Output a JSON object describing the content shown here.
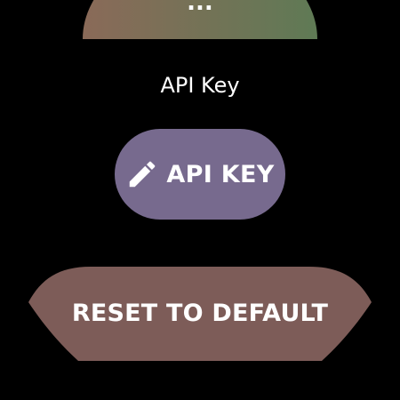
{
  "top_chip": {
    "label": "...",
    "color_from": "#8a6a58",
    "color_to": "#5f7a55"
  },
  "api_key_section": {
    "title": "API Key",
    "button_label": "API KEY",
    "button_icon": "pencil-icon",
    "button_color": "#776a8e"
  },
  "reset": {
    "label": "RESET TO DEFAULT",
    "color": "#7d5c58"
  }
}
